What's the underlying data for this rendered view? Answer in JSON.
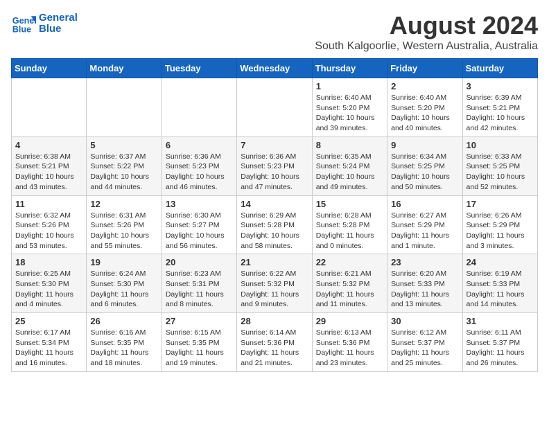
{
  "header": {
    "logo_line1": "General",
    "logo_line2": "Blue",
    "title": "August 2024",
    "subtitle": "South Kalgoorlie, Western Australia, Australia"
  },
  "weekdays": [
    "Sunday",
    "Monday",
    "Tuesday",
    "Wednesday",
    "Thursday",
    "Friday",
    "Saturday"
  ],
  "weeks": [
    [
      {
        "day": "",
        "info": ""
      },
      {
        "day": "",
        "info": ""
      },
      {
        "day": "",
        "info": ""
      },
      {
        "day": "",
        "info": ""
      },
      {
        "day": "1",
        "info": "Sunrise: 6:40 AM\nSunset: 5:20 PM\nDaylight: 10 hours\nand 39 minutes."
      },
      {
        "day": "2",
        "info": "Sunrise: 6:40 AM\nSunset: 5:20 PM\nDaylight: 10 hours\nand 40 minutes."
      },
      {
        "day": "3",
        "info": "Sunrise: 6:39 AM\nSunset: 5:21 PM\nDaylight: 10 hours\nand 42 minutes."
      }
    ],
    [
      {
        "day": "4",
        "info": "Sunrise: 6:38 AM\nSunset: 5:21 PM\nDaylight: 10 hours\nand 43 minutes."
      },
      {
        "day": "5",
        "info": "Sunrise: 6:37 AM\nSunset: 5:22 PM\nDaylight: 10 hours\nand 44 minutes."
      },
      {
        "day": "6",
        "info": "Sunrise: 6:36 AM\nSunset: 5:23 PM\nDaylight: 10 hours\nand 46 minutes."
      },
      {
        "day": "7",
        "info": "Sunrise: 6:36 AM\nSunset: 5:23 PM\nDaylight: 10 hours\nand 47 minutes."
      },
      {
        "day": "8",
        "info": "Sunrise: 6:35 AM\nSunset: 5:24 PM\nDaylight: 10 hours\nand 49 minutes."
      },
      {
        "day": "9",
        "info": "Sunrise: 6:34 AM\nSunset: 5:25 PM\nDaylight: 10 hours\nand 50 minutes."
      },
      {
        "day": "10",
        "info": "Sunrise: 6:33 AM\nSunset: 5:25 PM\nDaylight: 10 hours\nand 52 minutes."
      }
    ],
    [
      {
        "day": "11",
        "info": "Sunrise: 6:32 AM\nSunset: 5:26 PM\nDaylight: 10 hours\nand 53 minutes."
      },
      {
        "day": "12",
        "info": "Sunrise: 6:31 AM\nSunset: 5:26 PM\nDaylight: 10 hours\nand 55 minutes."
      },
      {
        "day": "13",
        "info": "Sunrise: 6:30 AM\nSunset: 5:27 PM\nDaylight: 10 hours\nand 56 minutes."
      },
      {
        "day": "14",
        "info": "Sunrise: 6:29 AM\nSunset: 5:28 PM\nDaylight: 10 hours\nand 58 minutes."
      },
      {
        "day": "15",
        "info": "Sunrise: 6:28 AM\nSunset: 5:28 PM\nDaylight: 11 hours\nand 0 minutes."
      },
      {
        "day": "16",
        "info": "Sunrise: 6:27 AM\nSunset: 5:29 PM\nDaylight: 11 hours\nand 1 minute."
      },
      {
        "day": "17",
        "info": "Sunrise: 6:26 AM\nSunset: 5:29 PM\nDaylight: 11 hours\nand 3 minutes."
      }
    ],
    [
      {
        "day": "18",
        "info": "Sunrise: 6:25 AM\nSunset: 5:30 PM\nDaylight: 11 hours\nand 4 minutes."
      },
      {
        "day": "19",
        "info": "Sunrise: 6:24 AM\nSunset: 5:30 PM\nDaylight: 11 hours\nand 6 minutes."
      },
      {
        "day": "20",
        "info": "Sunrise: 6:23 AM\nSunset: 5:31 PM\nDaylight: 11 hours\nand 8 minutes."
      },
      {
        "day": "21",
        "info": "Sunrise: 6:22 AM\nSunset: 5:32 PM\nDaylight: 11 hours\nand 9 minutes."
      },
      {
        "day": "22",
        "info": "Sunrise: 6:21 AM\nSunset: 5:32 PM\nDaylight: 11 hours\nand 11 minutes."
      },
      {
        "day": "23",
        "info": "Sunrise: 6:20 AM\nSunset: 5:33 PM\nDaylight: 11 hours\nand 13 minutes."
      },
      {
        "day": "24",
        "info": "Sunrise: 6:19 AM\nSunset: 5:33 PM\nDaylight: 11 hours\nand 14 minutes."
      }
    ],
    [
      {
        "day": "25",
        "info": "Sunrise: 6:17 AM\nSunset: 5:34 PM\nDaylight: 11 hours\nand 16 minutes."
      },
      {
        "day": "26",
        "info": "Sunrise: 6:16 AM\nSunset: 5:35 PM\nDaylight: 11 hours\nand 18 minutes."
      },
      {
        "day": "27",
        "info": "Sunrise: 6:15 AM\nSunset: 5:35 PM\nDaylight: 11 hours\nand 19 minutes."
      },
      {
        "day": "28",
        "info": "Sunrise: 6:14 AM\nSunset: 5:36 PM\nDaylight: 11 hours\nand 21 minutes."
      },
      {
        "day": "29",
        "info": "Sunrise: 6:13 AM\nSunset: 5:36 PM\nDaylight: 11 hours\nand 23 minutes."
      },
      {
        "day": "30",
        "info": "Sunrise: 6:12 AM\nSunset: 5:37 PM\nDaylight: 11 hours\nand 25 minutes."
      },
      {
        "day": "31",
        "info": "Sunrise: 6:11 AM\nSunset: 5:37 PM\nDaylight: 11 hours\nand 26 minutes."
      }
    ]
  ]
}
